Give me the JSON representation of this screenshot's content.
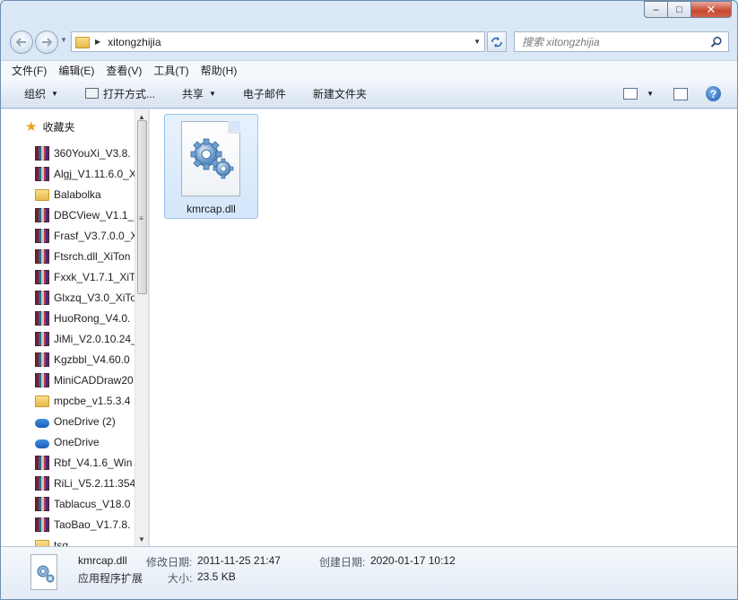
{
  "window": {
    "caption_buttons": {
      "minimize": "‒",
      "maximize": "□",
      "close": "✕"
    }
  },
  "address_bar": {
    "path_segment": "xitongzhijia",
    "search_placeholder": "搜索 xitongzhijia"
  },
  "menu": [
    "文件(F)",
    "编辑(E)",
    "查看(V)",
    "工具(T)",
    "帮助(H)"
  ],
  "toolbar": {
    "organize": "组织",
    "open_with": "打开方式...",
    "share": "共享",
    "email": "电子邮件",
    "new_folder": "新建文件夹"
  },
  "nav_pane": {
    "favorites_label": "收藏夹",
    "items": [
      {
        "label": "360YouXi_V3.8.",
        "icon": "archive-icon"
      },
      {
        "label": "Algj_V1.11.6.0_X",
        "icon": "archive-icon"
      },
      {
        "label": "Balabolka",
        "icon": "folder-icon"
      },
      {
        "label": "DBCView_V1.1_",
        "icon": "archive-icon"
      },
      {
        "label": "Frasf_V3.7.0.0_X",
        "icon": "archive-icon"
      },
      {
        "label": "Ftsrch.dll_XiTon",
        "icon": "archive-icon"
      },
      {
        "label": "Fxxk_V1.7.1_XiT",
        "icon": "archive-icon"
      },
      {
        "label": "Glxzq_V3.0_XiTo",
        "icon": "archive-icon"
      },
      {
        "label": "HuoRong_V4.0.",
        "icon": "archive-icon"
      },
      {
        "label": "JiMi_V2.0.10.24_",
        "icon": "archive-icon"
      },
      {
        "label": "Kgzbbl_V4.60.0",
        "icon": "archive-icon"
      },
      {
        "label": "MiniCADDraw20",
        "icon": "archive-icon"
      },
      {
        "label": "mpcbe_v1.5.3.4",
        "icon": "folder-icon"
      },
      {
        "label": "OneDrive (2)",
        "icon": "cloud-icon"
      },
      {
        "label": "OneDrive",
        "icon": "cloud-icon"
      },
      {
        "label": "Rbf_V4.1.6_Win",
        "icon": "archive-icon"
      },
      {
        "label": "RiLi_V5.2.11.354",
        "icon": "archive-icon"
      },
      {
        "label": "Tablacus_V18.0",
        "icon": "archive-icon"
      },
      {
        "label": "TaoBao_V1.7.8.",
        "icon": "archive-icon"
      },
      {
        "label": "tsq",
        "icon": "folder-icon"
      }
    ]
  },
  "content": {
    "files": [
      {
        "name": "kmrcap.dll",
        "icon": "dll-gear-icon"
      }
    ]
  },
  "details": {
    "name": "kmrcap.dll",
    "type": "应用程序扩展",
    "modified_label": "修改日期:",
    "modified_value": "2011-11-25 21:47",
    "size_label": "大小:",
    "size_value": "23.5 KB",
    "created_label": "创建日期:",
    "created_value": "2020-01-17 10:12"
  }
}
